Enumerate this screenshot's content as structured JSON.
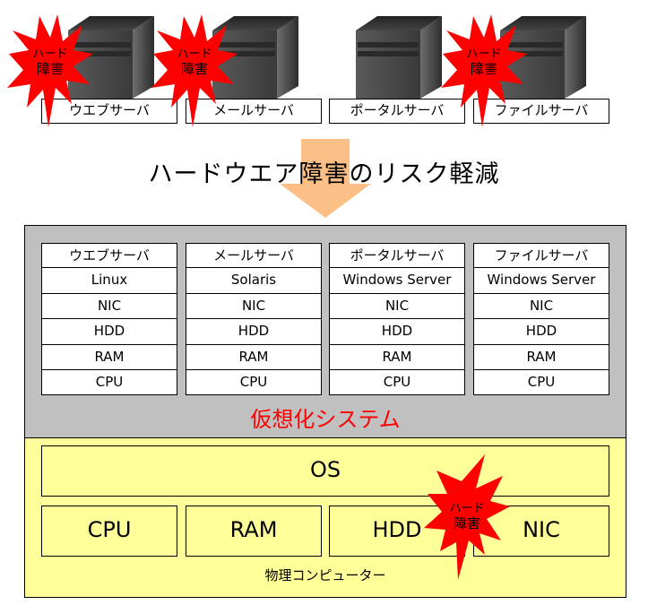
{
  "top_servers": [
    {
      "label": "ウエブサーバ",
      "hard_failure": true
    },
    {
      "label": "メールサーバ",
      "hard_failure": true
    },
    {
      "label": "ポータルサーバ",
      "hard_failure": false
    },
    {
      "label": "ファイルサーバ",
      "hard_failure": true
    }
  ],
  "burst_label": {
    "line1": "ハード",
    "line2": "障害"
  },
  "title": "ハードウエア障害のリスク軽減",
  "virtualization": {
    "label": "仮想化システム",
    "servers": [
      {
        "name": "ウエブサーバ",
        "os": "Linux",
        "components": [
          "NIC",
          "HDD",
          "RAM",
          "CPU"
        ]
      },
      {
        "name": "メールサーバ",
        "os": "Solaris",
        "components": [
          "NIC",
          "HDD",
          "RAM",
          "CPU"
        ]
      },
      {
        "name": "ポータルサーバ",
        "os": "Windows Server",
        "components": [
          "NIC",
          "HDD",
          "RAM",
          "CPU"
        ]
      },
      {
        "name": "ファイルサーバ",
        "os": "Windows Server",
        "components": [
          "NIC",
          "HDD",
          "RAM",
          "CPU"
        ]
      }
    ]
  },
  "physical": {
    "label": "物理コンピューター",
    "os": "OS",
    "hardware": [
      "CPU",
      "RAM",
      "HDD",
      "NIC"
    ],
    "failure_on": "HDD/NIC"
  },
  "colors": {
    "burst": "#ff0000",
    "arrow": "#fcbf85",
    "virtualization_bg": "#c0c0c0",
    "physical_bg": "#ffff99",
    "virtualization_label": "#ff0000"
  }
}
